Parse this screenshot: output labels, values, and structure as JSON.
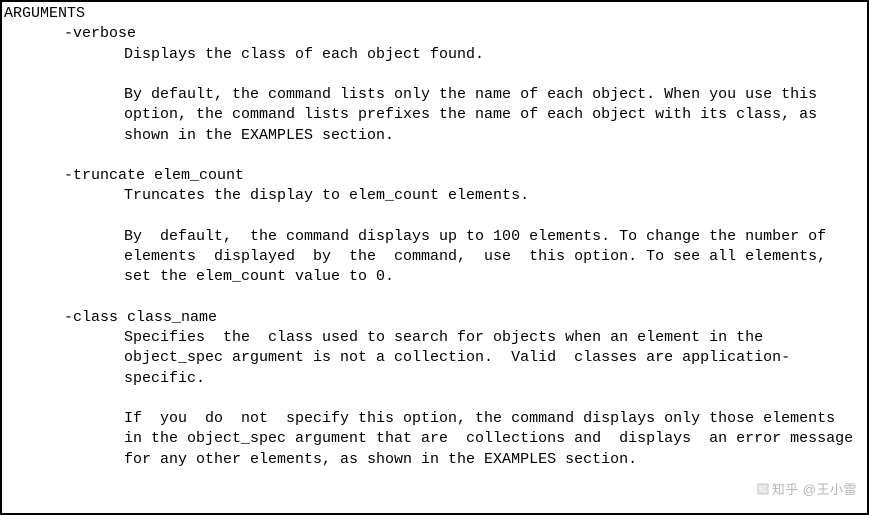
{
  "header": "ARGUMENTS",
  "args": [
    {
      "name": "-verbose",
      "paras": [
        "Displays the class of each object found.",
        "By default, the command lists only the name of each object. When you use this option, the command lists prefixes the name of each object with its class, as shown in the EXAMPLES section."
      ]
    },
    {
      "name": "-truncate elem_count",
      "paras": [
        "Truncates the display to elem_count elements.",
        "By  default,  the command displays up to 100 elements. To change the number of  elements  displayed  by  the  command,  use  this option. To see all elements, set the elem_count value to 0."
      ]
    },
    {
      "name": "-class class_name",
      "paras": [
        "Specifies  the  class used to search for objects when an element in the object_spec argument is not a collection.  Valid  classes are application-specific.",
        "If  you  do  not  specify this option, the command displays only those elements in the object_spec argument that are  collections and  displays  an error message for any other elements, as shown in the EXAMPLES section."
      ]
    }
  ],
  "watermark": "知乎 @王小雷"
}
